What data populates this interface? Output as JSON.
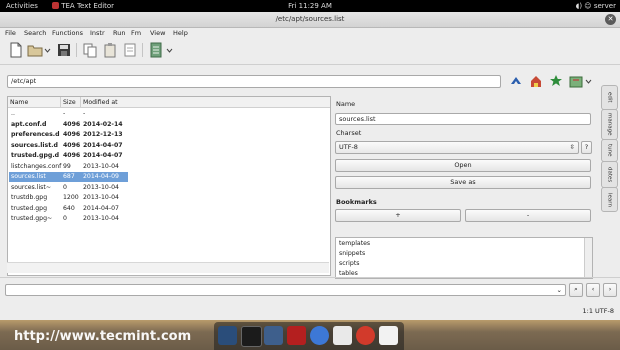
{
  "topbar": {
    "activities": "Activities",
    "app_name": "TEA Text Editor",
    "clock": "Fri 11:29 AM",
    "user": "server"
  },
  "window": {
    "title": "/etc/apt/sources.list",
    "close_glyph": "✕"
  },
  "menu": [
    "File",
    "Search",
    "Functions",
    "Instr",
    "Run",
    "Fm",
    "View",
    "Help"
  ],
  "toolbar_icons": [
    "new-file-icon",
    "open-folder-icon",
    "save-icon",
    "copy-icon",
    "paste-icon",
    "cut-icon",
    "document-icon"
  ],
  "file_manager": {
    "path": "/etc/apt",
    "columns": [
      "Name",
      "Size",
      "Modified at"
    ],
    "rows": [
      {
        "name": "..",
        "size": "-",
        "modified": "-",
        "bold": false
      },
      {
        "name": "apt.conf.d",
        "size": "4096",
        "modified": "2014-02-14",
        "bold": true
      },
      {
        "name": "preferences.d",
        "size": "4096",
        "modified": "2012-12-13",
        "bold": true
      },
      {
        "name": "sources.list.d",
        "size": "4096",
        "modified": "2014-04-07",
        "bold": true
      },
      {
        "name": "trusted.gpg.d",
        "size": "4096",
        "modified": "2014-04-07",
        "bold": true
      },
      {
        "name": "listchanges.conf",
        "size": "99",
        "modified": "2013-10-04",
        "bold": false
      },
      {
        "name": "sources.list",
        "size": "687",
        "modified": "2014-04-09",
        "bold": false,
        "selected": true
      },
      {
        "name": "sources.list~",
        "size": "0",
        "modified": "2013-10-04",
        "bold": false
      },
      {
        "name": "trustdb.gpg",
        "size": "1200",
        "modified": "2013-10-04",
        "bold": false
      },
      {
        "name": "trusted.gpg",
        "size": "640",
        "modified": "2014-04-07",
        "bold": false
      },
      {
        "name": "trusted.gpg~",
        "size": "0",
        "modified": "2013-10-04",
        "bold": false
      }
    ]
  },
  "panel": {
    "name_label": "Name",
    "name_value": "sources.list",
    "charset_label": "Charset",
    "charset_value": "UTF-8",
    "charset_help": "?",
    "open_button": "Open",
    "save_as_button": "Save as",
    "bookmarks_label": "Bookmarks",
    "add_button": "+",
    "remove_button": "-",
    "bookmarks": [
      "templates",
      "snippets",
      "scripts",
      "tables"
    ]
  },
  "side_tabs": [
    "edit",
    "manage",
    "tune",
    "dates",
    "learn"
  ],
  "statusbar": {
    "position": "1:1 UTF-8"
  },
  "watermark": "http://www.tecmint.com"
}
